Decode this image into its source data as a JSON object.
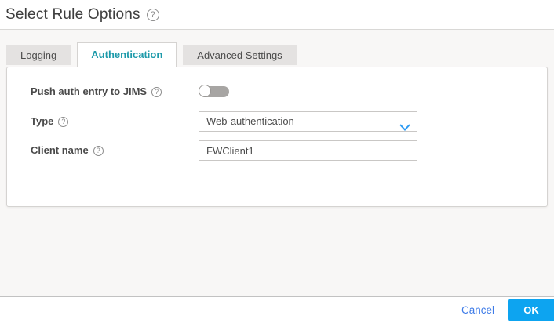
{
  "window": {
    "title": "Select Rule Options"
  },
  "icons": {
    "help": "?",
    "chevron_down": "chevron-down",
    "toggle_off": "toggle-off"
  },
  "tabs": {
    "items": [
      {
        "label": "Logging",
        "active": false
      },
      {
        "label": "Authentication",
        "active": true
      },
      {
        "label": "Advanced Settings",
        "active": false
      }
    ],
    "active_tab": "Authentication"
  },
  "form": {
    "push_auth": {
      "label": "Push auth entry to JIMS",
      "state": "off"
    },
    "type": {
      "label": "Type",
      "value": "Web-authentication"
    },
    "client_name": {
      "label": "Client name",
      "value": "FWClient1"
    }
  },
  "footer": {
    "cancel": "Cancel",
    "ok": "OK"
  },
  "colors": {
    "active_tab_text": "#1d9aaa",
    "inactive_tab_bg": "#e4e2e1",
    "ok_button_bg": "#0da4f0",
    "cancel_link": "#3f7ce8",
    "chevron": "#2b9af3",
    "body_bg": "#f8f7f6",
    "panel_border": "#d5d3d1",
    "toggle_track": "#a7a5a3"
  }
}
